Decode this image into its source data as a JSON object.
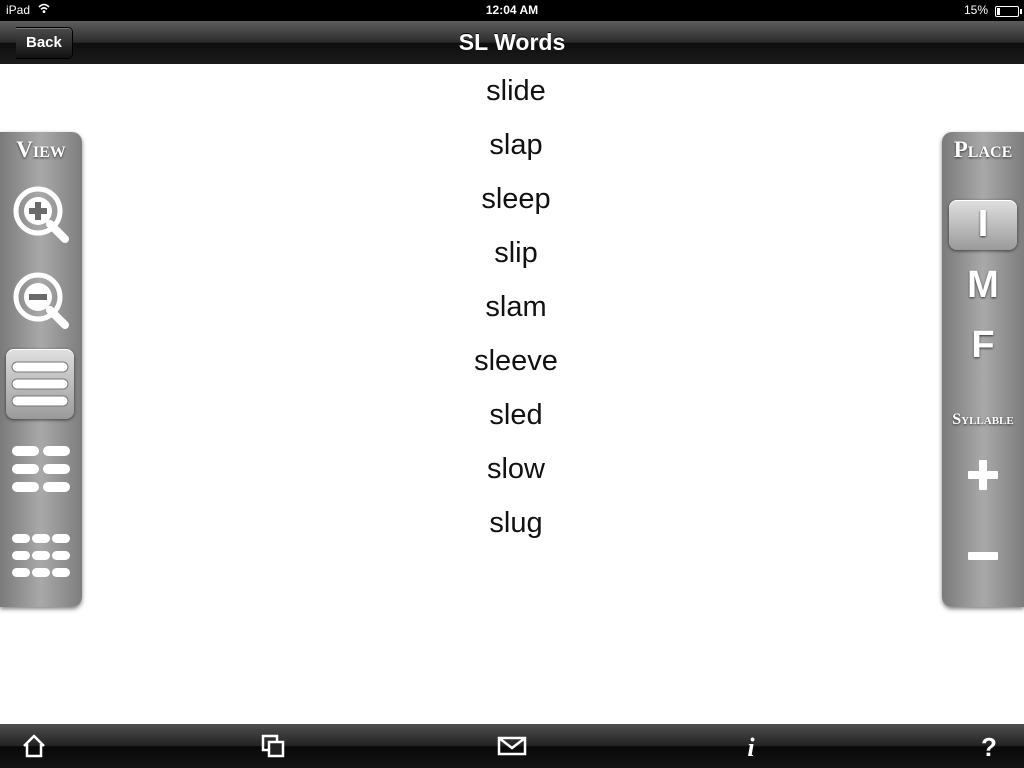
{
  "status_bar": {
    "carrier": "iPad",
    "time": "12:04 AM",
    "battery_percent": "15%",
    "battery_level": 0.15
  },
  "nav": {
    "title": "SL Words",
    "back_label": "Back"
  },
  "words": [
    "slide",
    "slap",
    "sleep",
    "slip",
    "slam",
    "sleeve",
    "sled",
    "slow",
    "slug"
  ],
  "view_panel": {
    "title": "View",
    "buttons": [
      "zoom-in-icon",
      "zoom-out-icon",
      "one-column-list-icon",
      "two-column-list-icon",
      "three-column-list-icon"
    ],
    "selected": "one-column-list-icon"
  },
  "place_panel": {
    "title": "Place",
    "positions": [
      "I",
      "M",
      "F"
    ],
    "selected": "I",
    "syllable_label": "Syllable",
    "syllable_buttons": [
      "plus-icon",
      "minus-icon"
    ]
  },
  "toolbar": {
    "icons": [
      "home-icon",
      "copy-icon",
      "mail-icon",
      "info-icon",
      "help-icon"
    ]
  }
}
